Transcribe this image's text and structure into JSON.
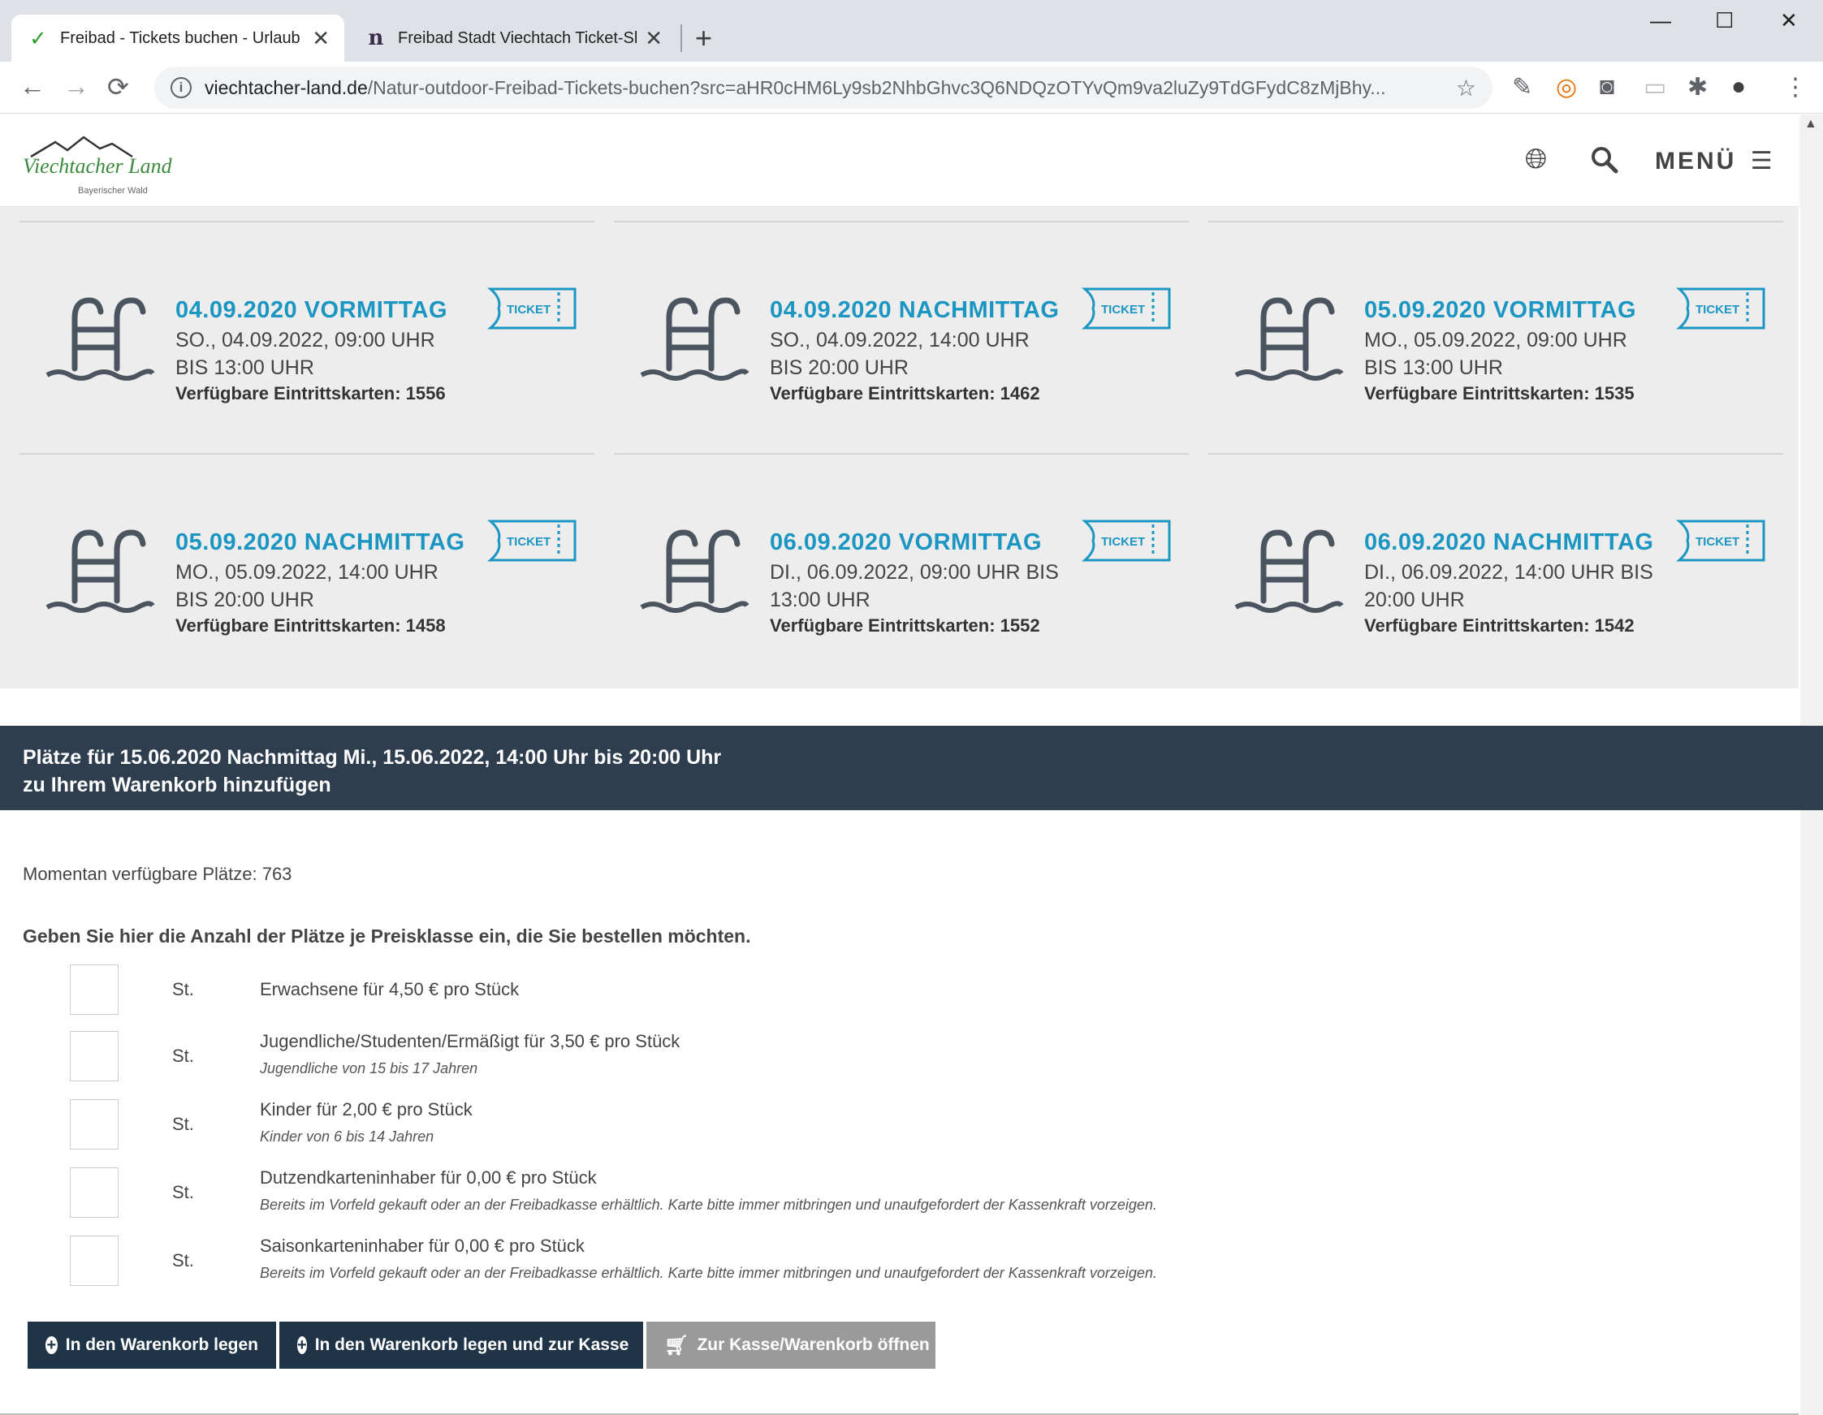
{
  "browser": {
    "tabs": [
      {
        "title": "Freibad - Tickets buchen - Urlaub",
        "close": "✕",
        "icon": "check-favicon"
      },
      {
        "title": "Freibad Stadt Viechtach Ticket-Sh",
        "close": "✕",
        "icon": "n-favicon"
      }
    ],
    "new_tab": "+",
    "window": {
      "minimize": "—",
      "maximize": "☐",
      "close": "✕"
    },
    "url_host": "viechtacher-land.de",
    "url_path": "/Natur-outdoor-Freibad-Tickets-buchen?src=aHR0cHM6Ly9sb2NhbGhvc3Q6NDQzOTYvQm9va2luZy9TdGFydC8zMjBhy..."
  },
  "site": {
    "logo_text": "Viechtacher Land",
    "logo_sub": "Bayerischer Wald",
    "menu_label": "MENÜ"
  },
  "cards": [
    {
      "title": "04.09.2020 VORMITTAG",
      "time": "SO., 04.09.2022, 09:00 UHR BIS 13:00 UHR",
      "avail": "Verfügbare Eintrittskarten: 1556",
      "ticket": "TICKET"
    },
    {
      "title": "04.09.2020 NACHMITTAG",
      "time": "SO., 04.09.2022, 14:00 UHR BIS 20:00 UHR",
      "avail": "Verfügbare Eintrittskarten: 1462",
      "ticket": "TICKET"
    },
    {
      "title": "05.09.2020 VORMITTAG",
      "time": "MO., 05.09.2022, 09:00 UHR BIS 13:00 UHR",
      "avail": "Verfügbare Eintrittskarten: 1535",
      "ticket": "TICKET"
    },
    {
      "title": "05.09.2020 NACHMITTAG",
      "time": "MO., 05.09.2022, 14:00 UHR BIS 20:00 UHR",
      "avail": "Verfügbare Eintrittskarten: 1458",
      "ticket": "TICKET"
    },
    {
      "title": "06.09.2020 VORMITTAG",
      "time": "DI., 06.09.2022, 09:00 UHR BIS 13:00 UHR",
      "avail": "Verfügbare Eintrittskarten: 1552",
      "ticket": "TICKET"
    },
    {
      "title": "06.09.2020 NACHMITTAG",
      "time": "DI., 06.09.2022, 14:00 UHR BIS 20:00 UHR",
      "avail": "Verfügbare Eintrittskarten: 1542",
      "ticket": "TICKET"
    }
  ],
  "booking": {
    "header_line1": "Plätze für 15.06.2020 Nachmittag Mi., 15.06.2022, 14:00 Uhr bis 20:00 Uhr",
    "header_line2": "zu Ihrem Warenkorb hinzufügen",
    "available_now": "Momentan verfügbare Plätze: 763",
    "instruction": "Geben Sie hier die Anzahl der Plätze je Preisklasse ein, die Sie bestellen möchten.",
    "unit": "St.",
    "price_classes": [
      {
        "title": "Erwachsene für 4,50 € pro Stück",
        "note": "",
        "value": ""
      },
      {
        "title": "Jugendliche/Studenten/Ermäßigt für 3,50 € pro Stück",
        "note": "Jugendliche von 15 bis 17 Jahren",
        "value": ""
      },
      {
        "title": "Kinder für 2,00 € pro Stück",
        "note": "Kinder von 6 bis 14 Jahren",
        "value": ""
      },
      {
        "title": "Dutzendkarteninhaber für 0,00 € pro Stück",
        "note": "Bereits im Vorfeld gekauft oder an der Freibadkasse erhältlich. Karte bitte immer mitbringen und unaufgefordert der Kassenkraft vorzeigen.",
        "value": ""
      },
      {
        "title": "Saisonkarteninhaber für 0,00 € pro Stück",
        "note": "Bereits im Vorfeld gekauft oder an der Freibadkasse erhältlich. Karte bitte immer mitbringen und unaufgefordert der Kassenkraft vorzeigen.",
        "value": ""
      }
    ],
    "buttons": {
      "add": "In den Warenkorb legen",
      "add_checkout": "In den Warenkorb legen und zur Kasse",
      "open_cart": "Zur Kasse/Warenkorb öffnen"
    }
  },
  "colors": {
    "accent": "#1b96c2",
    "header_bar": "#2e3e4e",
    "button": "#1f3447",
    "button_disabled": "#9a9a9a",
    "logo_green": "#3b8a3e"
  }
}
